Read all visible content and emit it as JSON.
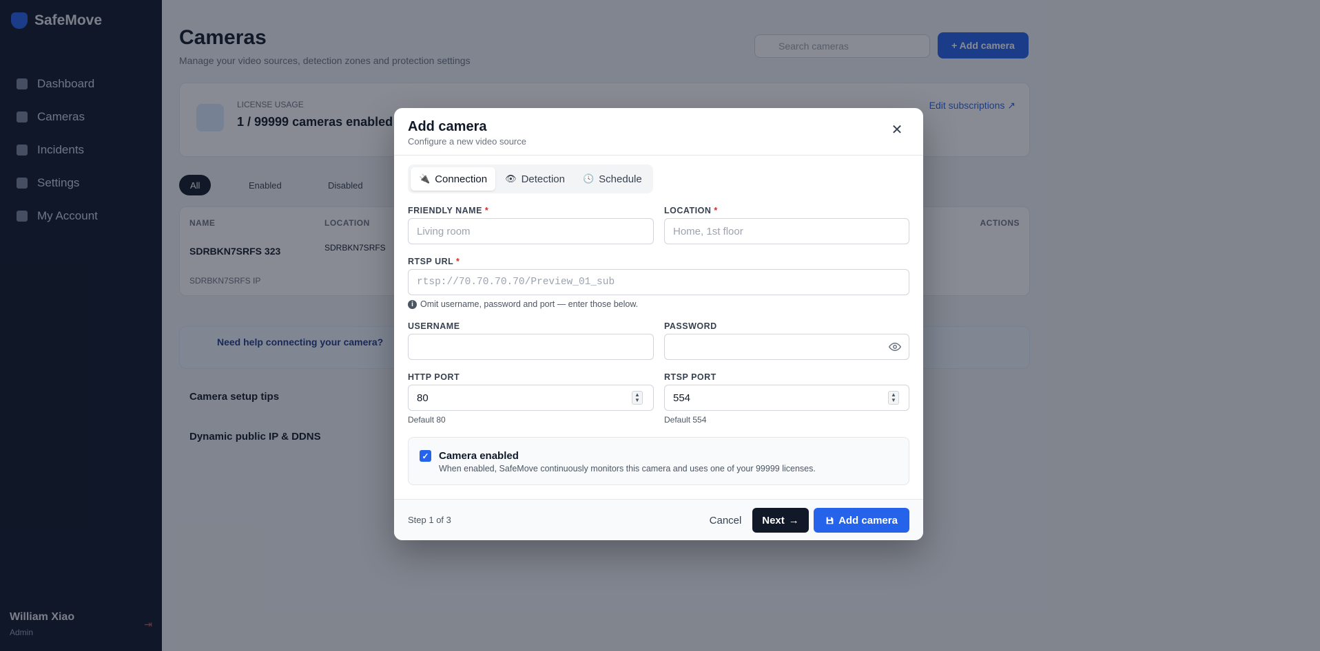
{
  "sidebar": {
    "brand": "SafeMove",
    "items": [
      {
        "label": "Dashboard"
      },
      {
        "label": "Cameras"
      },
      {
        "label": "Incidents"
      },
      {
        "label": "Settings"
      },
      {
        "label": "My Account"
      }
    ],
    "user": {
      "name": "William Xiao",
      "role": "Admin"
    },
    "logout": "⇥"
  },
  "page": {
    "title": "Cameras",
    "subtitle": "Manage your video sources, detection zones and protection settings",
    "search_placeholder": "Search cameras",
    "add_button": "+ Add camera",
    "license_label": "LICENSE USAGE",
    "license_value": "1 / 99999 cameras enabled",
    "manage_link": "Edit subscriptions ↗",
    "filters": [
      "All",
      "Enabled",
      "Disabled"
    ],
    "table": {
      "headers": [
        "NAME",
        "LOCATION",
        "ACTIONS"
      ],
      "row": {
        "name": "SDRBKN7SRFS 323",
        "location": "SDRBKN7SRFS"
      },
      "footer": "SDRBKN7SRFS IP"
    },
    "help_text": "Need help connecting your camera?",
    "accordions": [
      "Camera setup tips",
      "Dynamic public IP & DDNS"
    ]
  },
  "modal": {
    "title": "Add camera",
    "subtitle": "Configure a new video source",
    "close": "✕",
    "tabs": [
      {
        "label": "Connection",
        "icon": "plug-icon",
        "glyph": "🔌"
      },
      {
        "label": "Detection",
        "icon": "eye-icon",
        "glyph": "👁"
      },
      {
        "label": "Schedule",
        "icon": "clock-icon",
        "glyph": "🕓"
      }
    ],
    "fields": {
      "friendly_name": {
        "label": "FRIENDLY NAME",
        "placeholder": "Living room",
        "value": ""
      },
      "location": {
        "label": "LOCATION",
        "placeholder": "Home, 1st floor",
        "value": ""
      },
      "rtsp_url": {
        "label": "RTSP URL",
        "placeholder": "rtsp://70.70.70.70/Preview_01_sub",
        "value": ""
      },
      "rtsp_hint": "Omit username, password and port — enter those below.",
      "username": {
        "label": "USERNAME",
        "value": ""
      },
      "password": {
        "label": "PASSWORD",
        "value": ""
      },
      "http_port": {
        "label": "HTTP PORT",
        "value": "80",
        "hint": "Default 80"
      },
      "rtsp_port": {
        "label": "RTSP PORT",
        "value": "554",
        "hint": "Default 554"
      }
    },
    "required_marker": "*",
    "enabled": {
      "checked": true,
      "title": "Camera enabled",
      "description": "When enabled, SafeMove continuously monitors this camera and uses one of your 99999 licenses."
    },
    "footer": {
      "step": "Step 1 of 3",
      "cancel": "Cancel",
      "next": "Next",
      "add": "Add camera"
    }
  },
  "colors": {
    "accent": "#2563eb",
    "sidebar_bg": "#0f172a",
    "required": "#dc2626",
    "dark_button": "#111827"
  }
}
